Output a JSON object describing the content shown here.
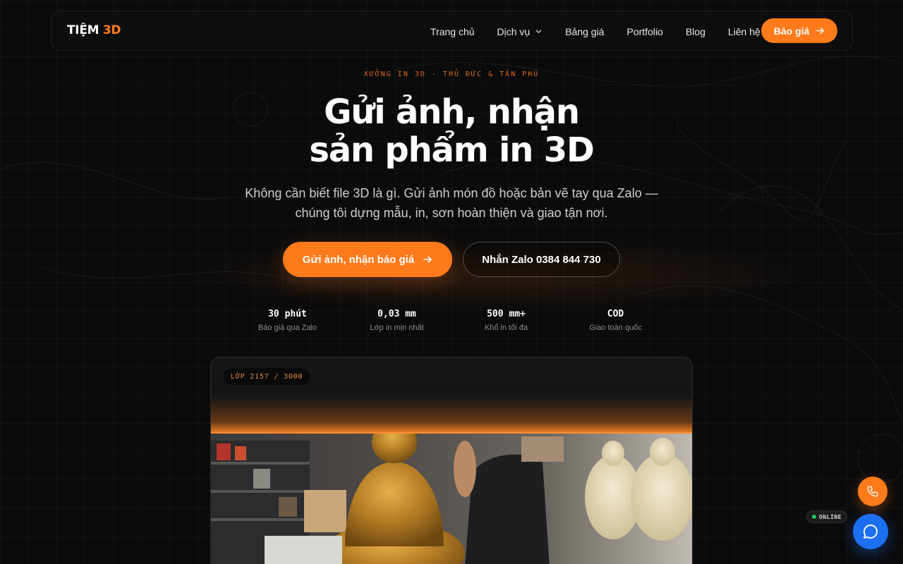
{
  "brand": {
    "name_part1": "TIỆM",
    "name_part2": "3D"
  },
  "nav": {
    "links": [
      "Trang chủ",
      "Dịch vụ",
      "Bảng giá",
      "Portfolio",
      "Blog",
      "Liên hệ"
    ],
    "cta_label": "Báo giá"
  },
  "hero": {
    "eyebrow": "XƯỞNG IN 3D · THỦ ĐỨC & TÂN PHÚ",
    "title_line1": "Gửi ảnh, nhận",
    "title_line2": "sản phẩm in 3D",
    "subtitle_line1": "Không cần biết file 3D là gì. Gửi ảnh món đồ hoặc bản vẽ tay qua Zalo —",
    "subtitle_line2": "chúng tôi dựng mẫu, in, sơn hoàn thiện và giao tận nơi.",
    "primary_button": "Gửi ảnh, nhận báo giá",
    "secondary_button": "Nhắn Zalo 0384 844 730"
  },
  "stats": [
    {
      "value": "30 phút",
      "label": "Báo giá qua Zalo"
    },
    {
      "value": "0,03 mm",
      "label": "Lớp in mịn nhất"
    },
    {
      "value": "500 mm+",
      "label": "Khổ in tối đa"
    },
    {
      "value": "COD",
      "label": "Giao toàn quốc"
    }
  ],
  "preview": {
    "layer_badge": "LỚP 2157 / 3000"
  },
  "floating": {
    "online_label": "ONLINE"
  },
  "colors": {
    "accent": "#ff7a1a",
    "background": "#0b0b0c",
    "chat_blue": "#1d6ff2",
    "online_green": "#22c55e"
  },
  "icons": [
    "chevron-down-icon",
    "arrow-right-icon",
    "phone-icon",
    "chat-icon"
  ]
}
